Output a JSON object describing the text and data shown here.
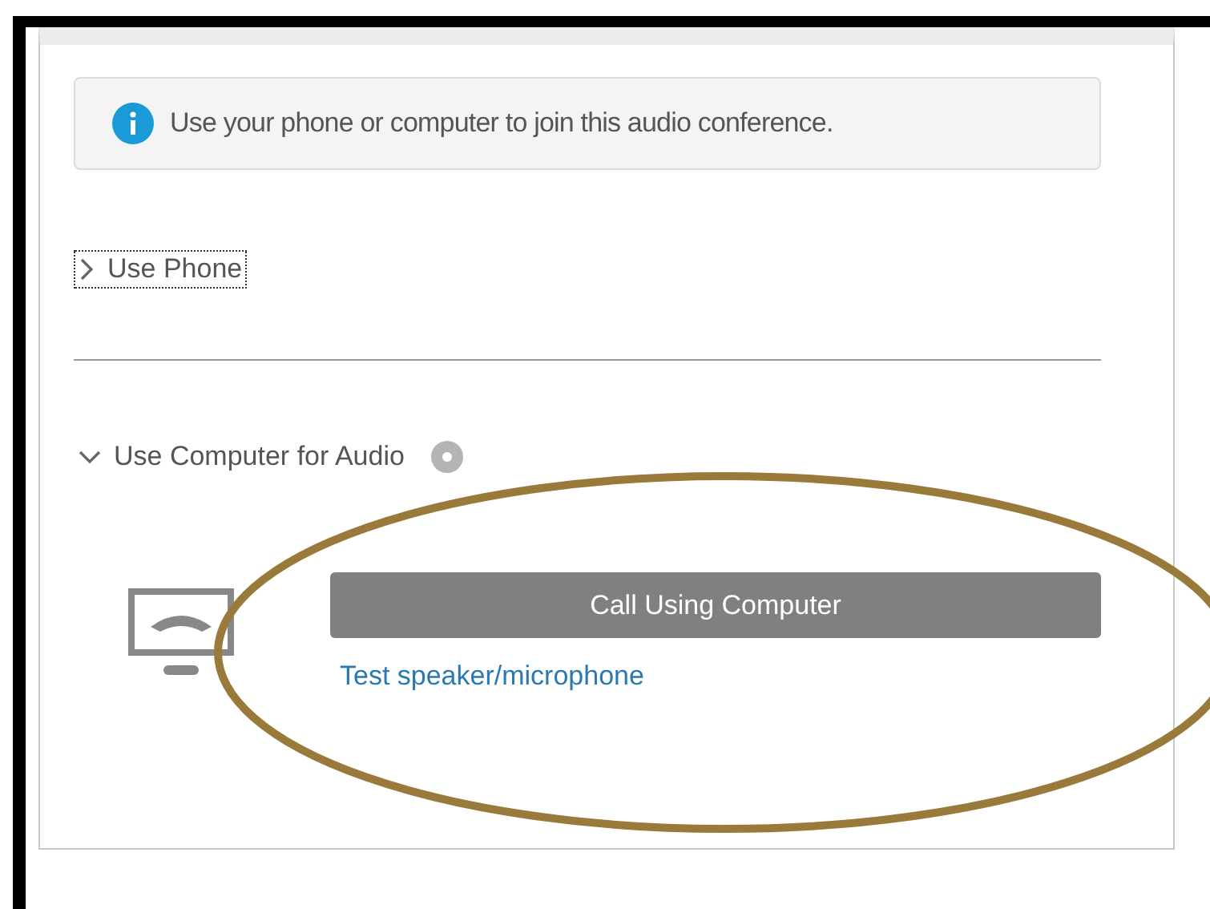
{
  "info": {
    "text": "Use your phone or computer to join this audio conference."
  },
  "sections": [
    {
      "label": "Use Phone",
      "expanded": false,
      "focused": true,
      "help": false
    },
    {
      "label": "Use Computer for Audio",
      "expanded": true,
      "focused": false,
      "help": true
    }
  ],
  "computer_audio": {
    "button": "Call Using Computer",
    "link": "Test speaker/microphone"
  },
  "annotation": {
    "kind": "ellipse",
    "color": "#9a7a3a"
  }
}
